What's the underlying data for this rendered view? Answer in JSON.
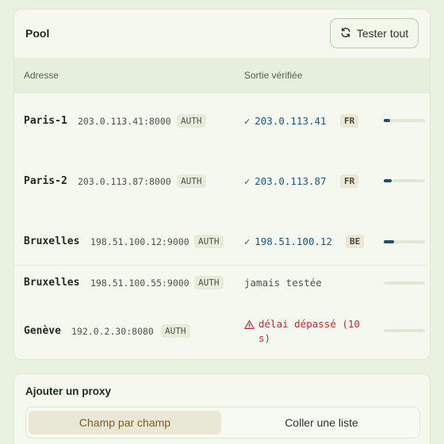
{
  "pool": {
    "title": "Pool",
    "test_all_label": "Tester tout",
    "columns": {
      "address": "Adresse",
      "output": "Sortie vérifiée"
    },
    "rows": [
      {
        "name": "Paris-1",
        "address": "203.0.113.41:8000",
        "auth": "AUTH",
        "status": "ok",
        "ip": "203.0.113.41",
        "country": "FR",
        "score": 0.15
      },
      {
        "name": "Paris-2",
        "address": "203.0.113.87:8000",
        "auth": "AUTH",
        "status": "ok",
        "ip": "203.0.113.87",
        "country": "FR",
        "score": 0.2
      },
      {
        "name": "Bruxelles",
        "address": "198.51.100.12:9000",
        "auth": "AUTH",
        "status": "ok",
        "ip": "198.51.100.12",
        "country": "BE",
        "score": 0.25
      },
      {
        "name": "Bruxelles",
        "address": "198.51.100.55:9000",
        "auth": "AUTH",
        "status": "never",
        "text": "jamais testée",
        "score": 0
      },
      {
        "name": "Genève",
        "address": "192.0.2.30:8080",
        "auth": "AUTH",
        "status": "timeout",
        "text": "délai dépassé (10 s)",
        "score": 0
      }
    ]
  },
  "add_proxy": {
    "title": "Ajouter un proxy",
    "tabs": [
      {
        "label": "Champ par champ",
        "active": true
      },
      {
        "label": "Coller une liste",
        "active": false
      }
    ]
  },
  "colors": {
    "accent": "#1f5779",
    "error": "#b0302c",
    "bar_fill": "#1e4f70",
    "active_tab_text": "#7d5f1c"
  }
}
